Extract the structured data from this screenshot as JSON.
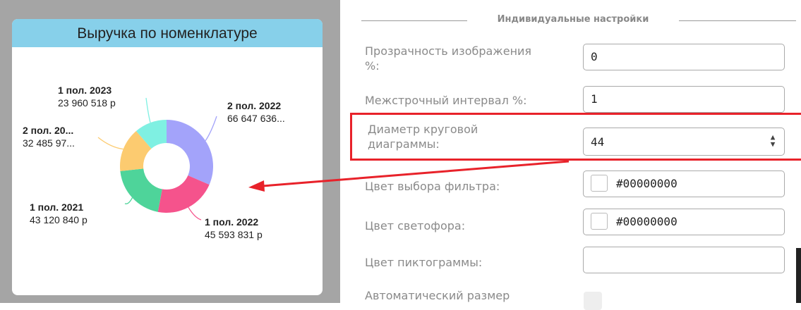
{
  "chart_card": {
    "title": "Выручка по номенклатуре"
  },
  "chart_data": {
    "type": "pie",
    "style": "donut",
    "title": "Выручка по номенклатуре",
    "slices": [
      {
        "label": "2 пол. 2022",
        "value_text": "66 647 636...",
        "color": "#a3a3fa"
      },
      {
        "label": "1 пол. 2022",
        "value_text": "45 593 831 р",
        "color": "#f5538c"
      },
      {
        "label": "1 пол. 2021",
        "value_text": "43 120 840 р",
        "color": "#4ed49a"
      },
      {
        "label": "2 пол. 20...",
        "value_text": "32 485 97...",
        "color": "#fccb70"
      },
      {
        "label": "1 пол. 2023",
        "value_text": "23 960 518 р",
        "color": "#7ff0e2"
      }
    ],
    "approx_values": [
      66647636,
      45593831,
      43120840,
      32485970,
      23960518
    ]
  },
  "settings": {
    "section_title": "Индивидуальные настройки",
    "opacity": {
      "label": "Прозрачность изображения %:",
      "label_line1": "Прозрачность изображения",
      "label_line2": "%:",
      "value": "0"
    },
    "line_spacing": {
      "label": "Межстрочный интервал %:",
      "value": "1"
    },
    "pie_diameter": {
      "label_line1": "Диаметр круговой",
      "label_line2": "диаграммы:",
      "value": "44"
    },
    "filter_color": {
      "label": "Цвет выбора фильтра:",
      "value": "#00000000"
    },
    "traffic_light_color": {
      "label": "Цвет светофора:",
      "value": "#00000000"
    },
    "icon_color": {
      "label": "Цвет пиктограммы:",
      "value": ""
    },
    "auto_size": {
      "label": "Автоматический размер"
    }
  },
  "annotation": {
    "highlight_color": "#e8222a"
  }
}
